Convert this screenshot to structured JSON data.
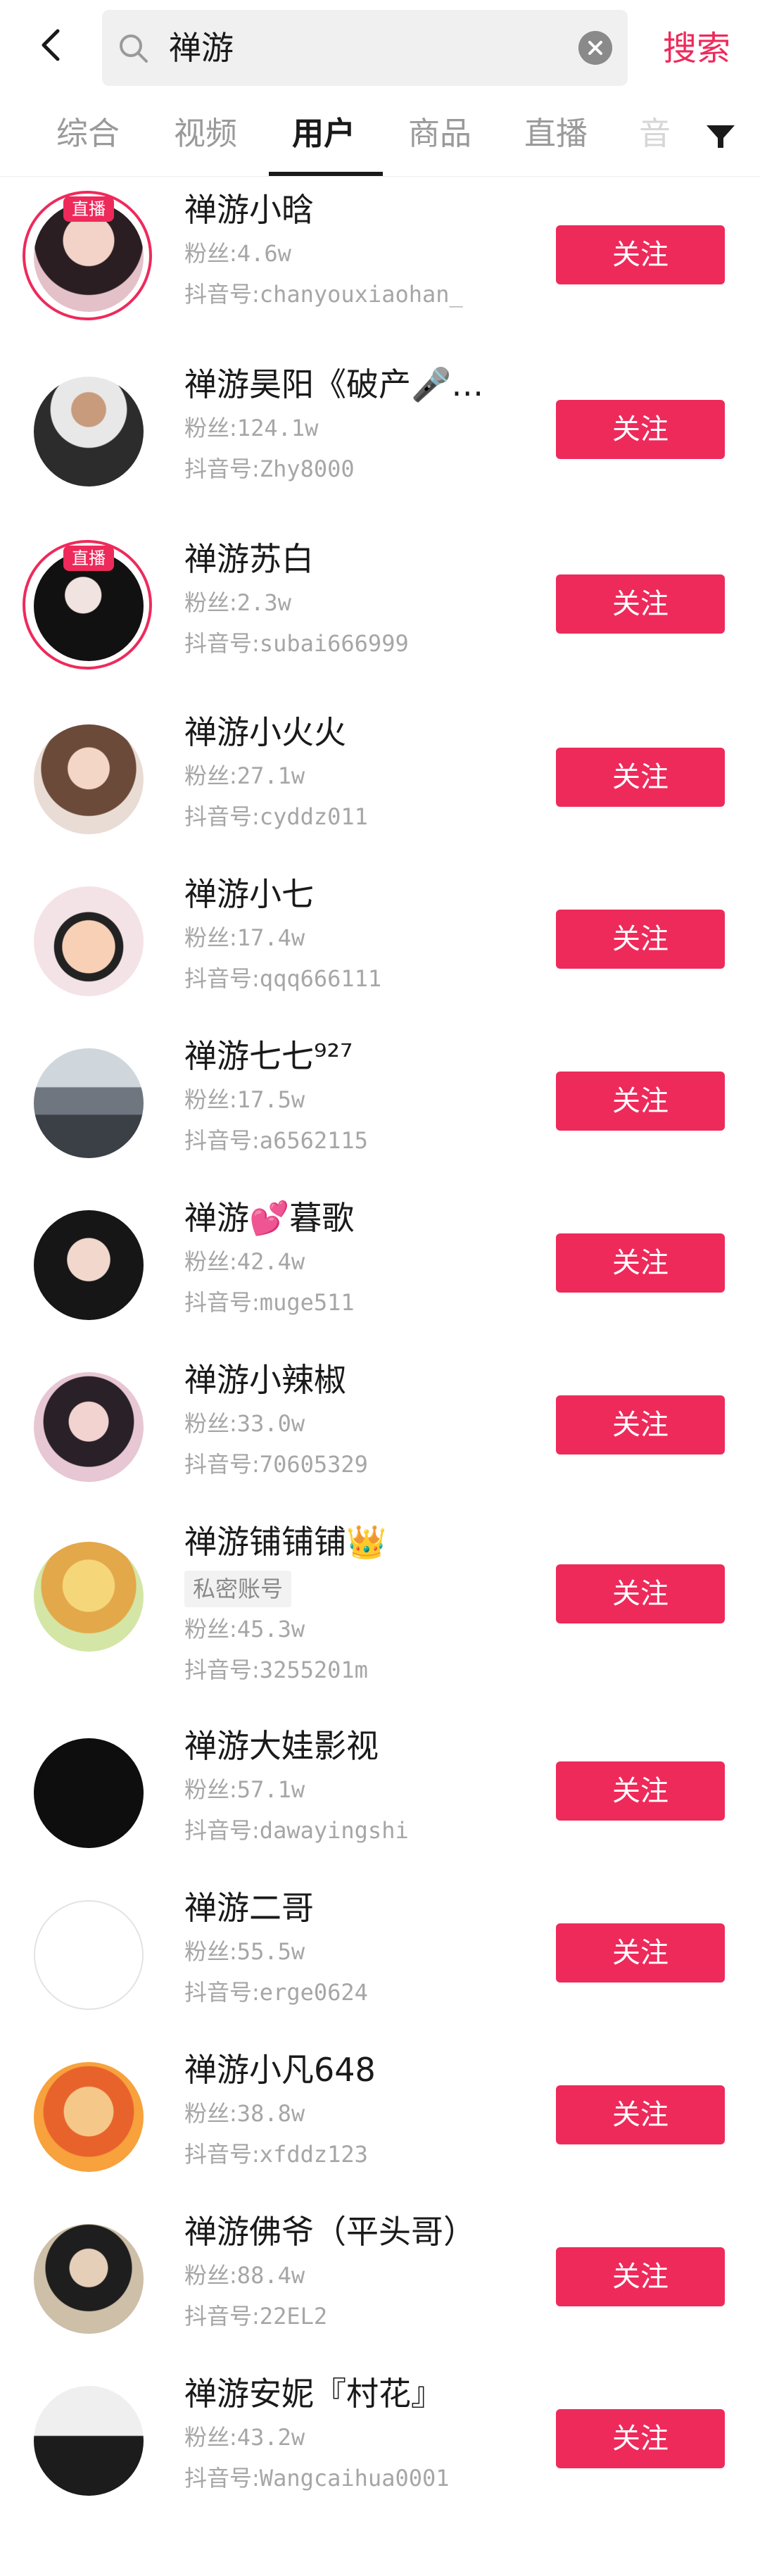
{
  "search": {
    "query": "禅游",
    "submit_label": "搜索"
  },
  "tabs": [
    {
      "label": "综合"
    },
    {
      "label": "视频"
    },
    {
      "label": "用户"
    },
    {
      "label": "商品"
    },
    {
      "label": "直播"
    },
    {
      "label": "音"
    }
  ],
  "active_tab": "用户",
  "labels": {
    "fans_prefix": "粉丝:",
    "id_prefix": "抖音号:",
    "follow": "关注",
    "live": "直播",
    "private": "私密账号"
  },
  "colors": {
    "accent": "#ee2a5b"
  },
  "users": [
    {
      "name": "禅游小晗",
      "fans": "4.6w",
      "douyin_id": "chanyouxiaohan_",
      "live": true
    },
    {
      "name": "禅游昊阳《破产🎤歌…",
      "fans": "124.1w",
      "douyin_id": "Zhy8000"
    },
    {
      "name": "禅游苏白",
      "fans": "2.3w",
      "douyin_id": "subai666999",
      "live": true
    },
    {
      "name": "禅游小火火",
      "fans": "27.1w",
      "douyin_id": "cyddz011"
    },
    {
      "name": "禅游小七",
      "fans": "17.4w",
      "douyin_id": "qqq666111"
    },
    {
      "name": "禅游七七⁹²⁷",
      "fans": "17.5w",
      "douyin_id": "a6562115"
    },
    {
      "name": "禅游💕暮歌",
      "fans": "42.4w",
      "douyin_id": "muge511"
    },
    {
      "name": "禅游小辣椒",
      "fans": "33.0w",
      "douyin_id": "70605329"
    },
    {
      "name": "禅游铺铺铺👑",
      "fans": "45.3w",
      "douyin_id": "3255201m",
      "private": true
    },
    {
      "name": "禅游大娃影视",
      "fans": "57.1w",
      "douyin_id": "dawayingshi"
    },
    {
      "name": "禅游二哥",
      "fans": "55.5w",
      "douyin_id": "erge0624"
    },
    {
      "name": "禅游小凡648",
      "fans": "38.8w",
      "douyin_id": "xfddz123"
    },
    {
      "name": "禅游佛爷（平头哥）",
      "fans": "88.4w",
      "douyin_id": "22EL2"
    },
    {
      "name": "禅游安妮『村花』",
      "fans": "43.2w",
      "douyin_id": "Wangcaihua0001"
    }
  ]
}
